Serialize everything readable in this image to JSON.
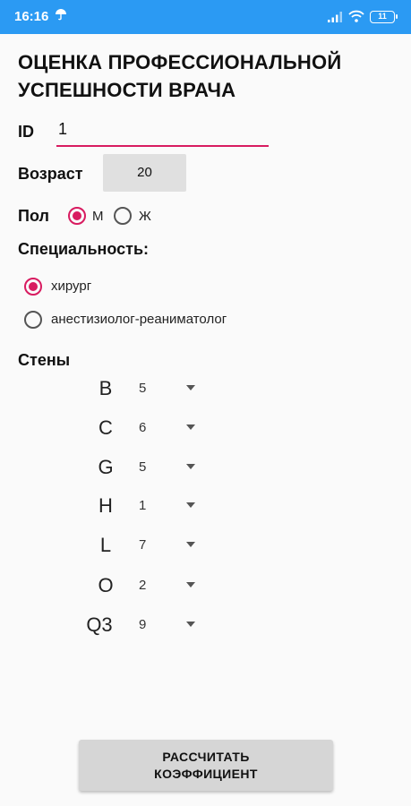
{
  "status_bar": {
    "time": "16:16",
    "battery": "11"
  },
  "title": "ОЦЕНКА ПРОФЕССИОНАЛЬНОЙ УСПЕШНОСТИ ВРАЧА",
  "id_field": {
    "label": "ID",
    "value": "1"
  },
  "age": {
    "label": "Возраст",
    "value": "20"
  },
  "gender": {
    "label": "Пол",
    "options": [
      {
        "label": "М",
        "selected": true
      },
      {
        "label": "Ж",
        "selected": false
      }
    ]
  },
  "specialty": {
    "label": "Специальность:",
    "options": [
      {
        "label": "хирург",
        "selected": true
      },
      {
        "label": "анестизиолог-реаниматолог",
        "selected": false
      }
    ]
  },
  "stens": {
    "label": "Стены",
    "rows": [
      {
        "scale": "B",
        "value": "5"
      },
      {
        "scale": "C",
        "value": "6"
      },
      {
        "scale": "G",
        "value": "5"
      },
      {
        "scale": "H",
        "value": "1"
      },
      {
        "scale": "L",
        "value": "7"
      },
      {
        "scale": "O",
        "value": "2"
      },
      {
        "scale": "Q3",
        "value": "9"
      }
    ]
  },
  "calculate_button": {
    "label": "РАССЧИТАТЬ\nКОЭФФИЦИЕНТ"
  },
  "colors": {
    "status_bar": "#2b9af3",
    "accent": "#d81b60",
    "background": "#fafafa"
  }
}
